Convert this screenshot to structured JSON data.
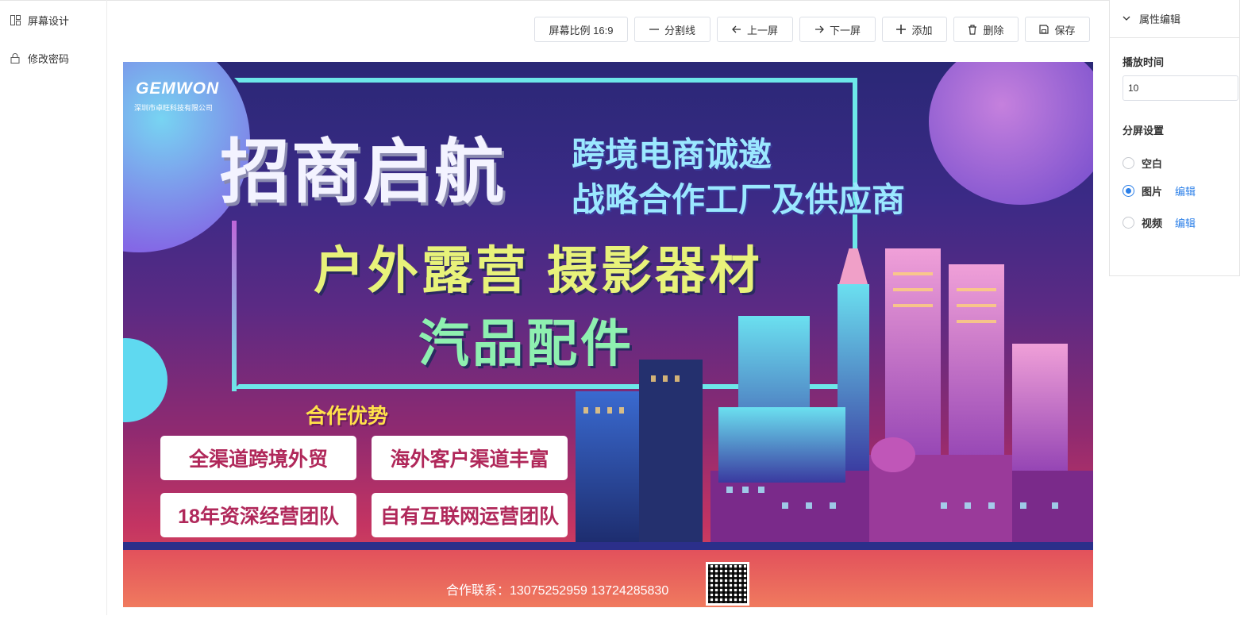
{
  "sidebar": {
    "items": [
      {
        "label": "屏幕设计",
        "icon": "layout-grid-icon"
      },
      {
        "label": "修改密码",
        "icon": "lock-icon"
      }
    ]
  },
  "toolbar": {
    "ratio_label": "屏幕比例 16:9",
    "divider_label": "分割线",
    "prev_label": "上一屏",
    "next_label": "下一屏",
    "add_label": "添加",
    "delete_label": "删除",
    "save_label": "保存"
  },
  "banner": {
    "brand": "GEMWON",
    "brand_sub": "深圳市卓旺科技有限公司",
    "headline": "招商启航",
    "subline_1": "跨境电商诚邀",
    "subline_2": "战略合作工厂及供应商",
    "category_1": "户外露营 摄影器材",
    "category_2": "汽品配件",
    "advantages_title": "合作优势",
    "advantages": [
      "全渠道跨境外贸",
      "海外客户渠道丰富",
      "18年资深经营团队",
      "自有互联网运营团队"
    ],
    "contact": "合作联系：13075252959   13724285830",
    "colors": {
      "bg_top": "#2a2876",
      "bg_bottom": "#e05a58",
      "frame": "#6de7e9",
      "headline_yellow": "#e8f27a",
      "headline_green": "#8ef0b0",
      "accent_yellow": "#ffe14a"
    }
  },
  "panel": {
    "title": "属性编辑",
    "duration_label": "播放时间",
    "duration_value": "10",
    "split_label": "分屏设置",
    "options": [
      {
        "label": "空白",
        "selected": false,
        "edit": ""
      },
      {
        "label": "图片",
        "selected": true,
        "edit": "编辑"
      },
      {
        "label": "视频",
        "selected": false,
        "edit": "编辑"
      }
    ]
  },
  "accent_color": "#2b7fe8"
}
